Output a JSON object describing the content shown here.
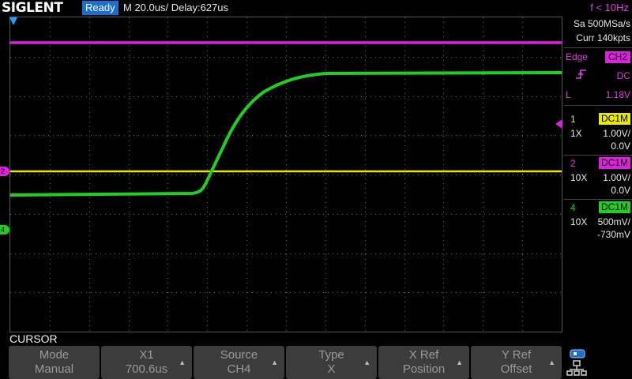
{
  "header": {
    "logo": "SIGLENT",
    "run_state": "Ready",
    "timebase": "M 20.0us/",
    "delay": "Delay:627us",
    "freq": "f < 10Hz"
  },
  "acquisition": {
    "sample_rate": "Sa 500MSa/s",
    "memory_depth": "Curr 140kpts"
  },
  "trigger": {
    "type": "Edge",
    "source": "CH2",
    "coupling": "DC",
    "level_label": "L",
    "level": "1.18V"
  },
  "channels": [
    {
      "num": "1",
      "coupling": "DC1M",
      "probe": "1X",
      "scale": "1.00V/",
      "offset": "0.0V",
      "color": "#e8e800"
    },
    {
      "num": "2",
      "coupling": "DC1M",
      "probe": "10X",
      "scale": "1.00V/",
      "offset": "0.0V",
      "color": "#e020e0"
    },
    {
      "num": "4",
      "coupling": "DC1M",
      "probe": "10X",
      "scale": "500mV/",
      "offset": "-730mV",
      "color": "#20d020"
    }
  ],
  "markers": {
    "ch2": "2",
    "ch4": "4"
  },
  "menu": {
    "title": "CURSOR",
    "keys": [
      {
        "label": "Mode",
        "value": "Manual"
      },
      {
        "label": "X1",
        "value": "700.6us"
      },
      {
        "label": "Source",
        "value": "CH4"
      },
      {
        "label": "Type",
        "value": "X"
      },
      {
        "label": "X Ref",
        "value": "Position"
      },
      {
        "label": "Y Ref",
        "value": "Offset"
      }
    ]
  },
  "colors": {
    "ch1": "#e8e800",
    "ch2": "#e020e0",
    "ch4": "#20d020",
    "accent": "#1a6fd0"
  },
  "icons": {
    "usb": "usb-icon",
    "network": "network-icon"
  }
}
